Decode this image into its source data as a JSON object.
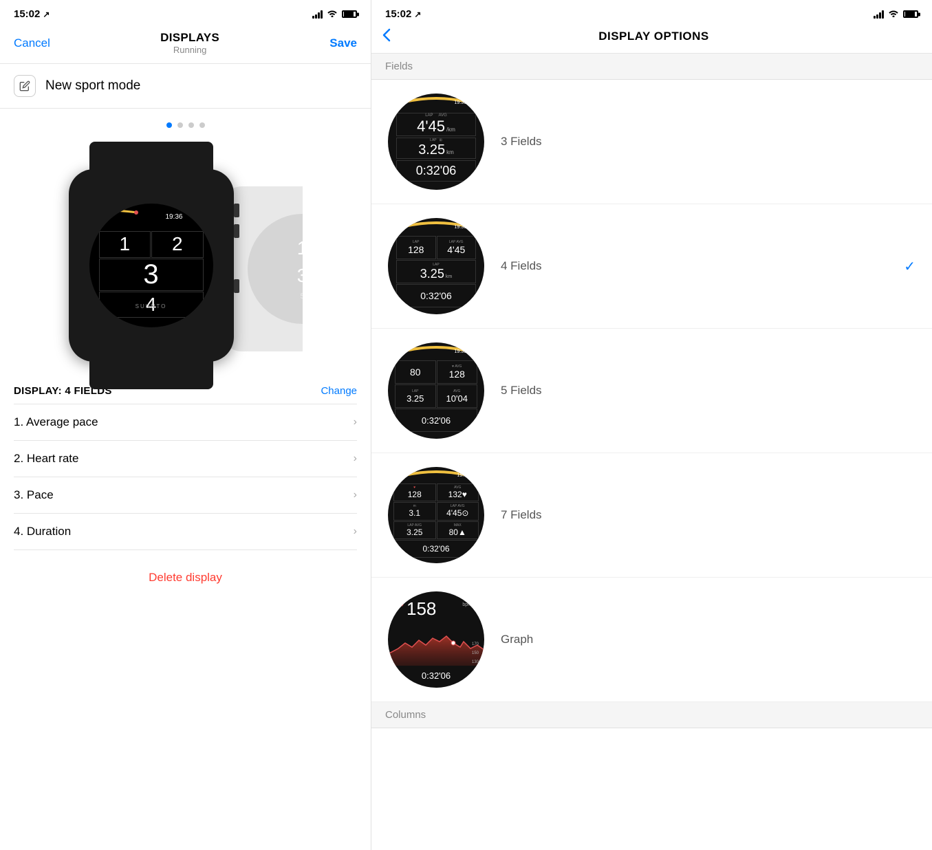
{
  "left": {
    "status_bar": {
      "time": "15:02",
      "nav_icon": "↗"
    },
    "nav": {
      "cancel": "Cancel",
      "title": "DISPLAYS",
      "subtitle": "Running",
      "save": "Save"
    },
    "sport_mode": {
      "label": "New sport mode"
    },
    "dots": [
      true,
      false,
      false,
      false
    ],
    "display_header": {
      "title": "DISPLAY: 4 FIELDS",
      "change": "Change"
    },
    "fields": [
      {
        "number": "1",
        "name": "Average pace"
      },
      {
        "number": "2",
        "name": "Heart rate"
      },
      {
        "number": "3",
        "name": "Pace"
      },
      {
        "number": "4",
        "name": "Duration"
      }
    ],
    "delete_label": "Delete display",
    "watch": {
      "time": "19:36",
      "fields": [
        "1",
        "2",
        "3",
        "4"
      ],
      "suunto": "SUUNTO"
    }
  },
  "right": {
    "status_bar": {
      "time": "15:02",
      "nav_icon": "↗"
    },
    "nav": {
      "back": "<",
      "title": "DISPLAY OPTIONS"
    },
    "sections": {
      "fields_label": "Fields",
      "columns_label": "Columns"
    },
    "options": [
      {
        "id": "3fields",
        "label": "3 Fields",
        "selected": false
      },
      {
        "id": "4fields",
        "label": "4 Fields",
        "selected": true
      },
      {
        "id": "5fields",
        "label": "5 Fields",
        "selected": false
      },
      {
        "id": "7fields",
        "label": "7 Fields",
        "selected": false
      },
      {
        "id": "graph",
        "label": "Graph",
        "selected": false
      }
    ]
  }
}
